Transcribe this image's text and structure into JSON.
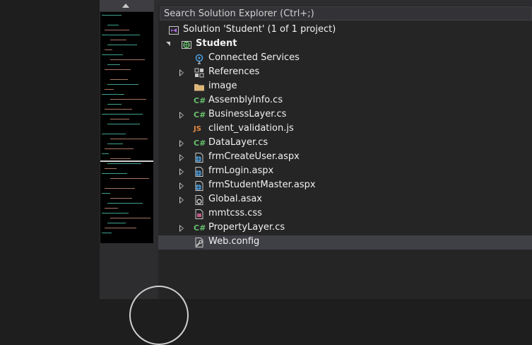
{
  "search": {
    "placeholder": "Search Solution Explorer (Ctrl+;)"
  },
  "solution": {
    "label": "Solution 'Student' (1 of 1 project)",
    "icon": "solution-icon"
  },
  "project": {
    "label": "Student",
    "icon": "web-project-icon",
    "expanded": true
  },
  "items": [
    {
      "label": "Connected Services",
      "icon": "connected-services-icon",
      "expander": "none"
    },
    {
      "label": "References",
      "icon": "references-icon",
      "expander": "collapsed"
    },
    {
      "label": "image",
      "icon": "folder-icon",
      "expander": "none"
    },
    {
      "label": "AssemblyInfo.cs",
      "icon": "csharp-icon",
      "expander": "none"
    },
    {
      "label": "BusinessLayer.cs",
      "icon": "csharp-icon",
      "expander": "collapsed"
    },
    {
      "label": "client_validation.js",
      "icon": "javascript-icon",
      "expander": "none"
    },
    {
      "label": "DataLayer.cs",
      "icon": "csharp-icon",
      "expander": "collapsed"
    },
    {
      "label": "frmCreateUser.aspx",
      "icon": "aspx-page-icon",
      "expander": "collapsed"
    },
    {
      "label": "frmLogin.aspx",
      "icon": "aspx-page-icon",
      "expander": "collapsed"
    },
    {
      "label": "frmStudentMaster.aspx",
      "icon": "aspx-page-icon",
      "expander": "collapsed"
    },
    {
      "label": "Global.asax",
      "icon": "global-asax-icon",
      "expander": "collapsed"
    },
    {
      "label": "mmtcss.css",
      "icon": "css-file-icon",
      "expander": "none"
    },
    {
      "label": "PropertyLayer.cs",
      "icon": "csharp-icon",
      "expander": "collapsed"
    },
    {
      "label": "Web.config",
      "icon": "config-file-icon",
      "expander": "none",
      "selected": true
    }
  ],
  "icon_text": {
    "csharp": "C#",
    "javascript": "JS"
  },
  "colors": {
    "background": "#252526",
    "selection": "#3f3f46",
    "csharp": "#67c06b",
    "javascript": "#e68a3f",
    "web": "#4a9fe0"
  }
}
